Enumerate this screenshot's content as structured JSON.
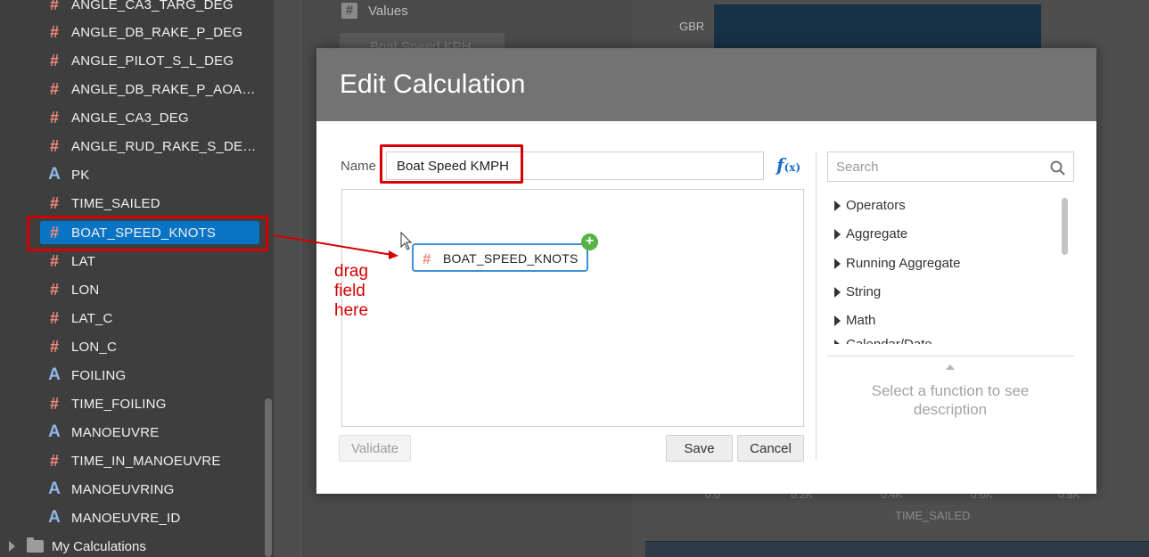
{
  "sidebar": {
    "fields": [
      {
        "label": "ANGLE_CA3_TARG_DEG",
        "type": "number"
      },
      {
        "label": "ANGLE_DB_RAKE_P_DEG",
        "type": "number"
      },
      {
        "label": "ANGLE_PILOT_S_L_DEG",
        "type": "number"
      },
      {
        "label": "ANGLE_DB_RAKE_P_AOA…",
        "type": "number"
      },
      {
        "label": "ANGLE_CA3_DEG",
        "type": "number"
      },
      {
        "label": "ANGLE_RUD_RAKE_S_DE…",
        "type": "number"
      },
      {
        "label": "PK",
        "type": "text"
      },
      {
        "label": "TIME_SAILED",
        "type": "number"
      },
      {
        "label": "BOAT_SPEED_KNOTS",
        "type": "number",
        "selected": true
      },
      {
        "label": "LAT",
        "type": "number"
      },
      {
        "label": "LON",
        "type": "number"
      },
      {
        "label": "LAT_C",
        "type": "number"
      },
      {
        "label": "LON_C",
        "type": "number"
      },
      {
        "label": "FOILING",
        "type": "text"
      },
      {
        "label": "TIME_FOILING",
        "type": "number"
      },
      {
        "label": "MANOEUVRE",
        "type": "text"
      },
      {
        "label": "TIME_IN_MANOEUVRE",
        "type": "number"
      },
      {
        "label": "MANOEUVRING",
        "type": "text"
      },
      {
        "label": "MANOEUVRE_ID",
        "type": "text"
      }
    ],
    "folder_label": "My Calculations",
    "icons": {
      "number": "hash-icon",
      "text": "text-a-icon",
      "folder": "folder-icon"
    }
  },
  "workspace": {
    "values_label": "Values",
    "chip_label": "Boat Speed KPH",
    "chart_category": "GBR",
    "axis_ticks": [
      "0.0",
      "0.2K",
      "0.4K",
      "0.6K",
      "0.8K"
    ],
    "axis_title": "TIME_SAILED"
  },
  "dialog": {
    "title": "Edit Calculation",
    "name_label": "Name",
    "name_value": "Boat Speed KMPH",
    "fx_icon": "function-icon",
    "expression_token": "BOAT_SPEED_KNOTS",
    "annotation": [
      "drag",
      "field",
      "here"
    ],
    "validate_label": "Validate",
    "save_label": "Save",
    "cancel_label": "Cancel",
    "search_placeholder": "Search",
    "function_categories": [
      "Operators",
      "Aggregate",
      "Running Aggregate",
      "String",
      "Math",
      "Calendar/Date"
    ],
    "function_description": "Select a function to see description"
  },
  "colors": {
    "selection": "#0a74c4",
    "highlight_red": "#d40000",
    "number_icon": "#f08a7e",
    "text_icon": "#8fb7e6",
    "add_green": "#57b346"
  }
}
